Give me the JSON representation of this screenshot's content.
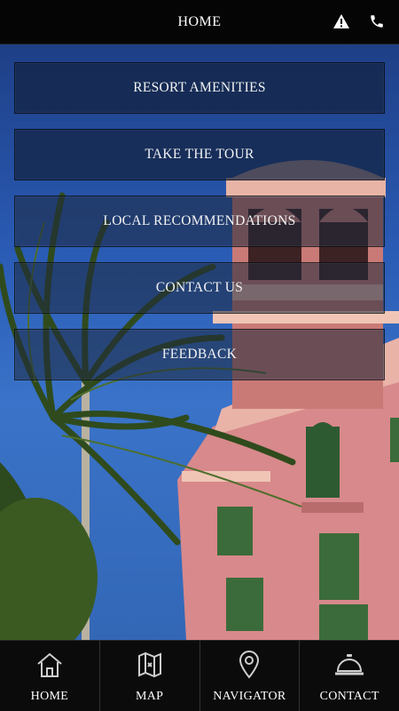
{
  "header": {
    "title": "HOME",
    "icons": [
      "alert-icon",
      "phone-icon"
    ]
  },
  "menu": {
    "items": [
      {
        "label": "RESORT AMENITIES"
      },
      {
        "label": "TAKE THE TOUR"
      },
      {
        "label": "LOCAL RECOMMENDATIONS"
      },
      {
        "label": "CONTACT US"
      },
      {
        "label": "FEEDBACK"
      }
    ]
  },
  "tabs": [
    {
      "label": "HOME",
      "icon": "home-icon"
    },
    {
      "label": "MAP",
      "icon": "map-icon"
    },
    {
      "label": "NAVIGATOR",
      "icon": "location-pin-icon"
    },
    {
      "label": "CONTACT",
      "icon": "service-bell-icon"
    }
  ],
  "colors": {
    "bar_background": "#0b0b0b",
    "button_background": "#122240",
    "sky": "#2a5bb5",
    "building": "#d98c8e"
  }
}
